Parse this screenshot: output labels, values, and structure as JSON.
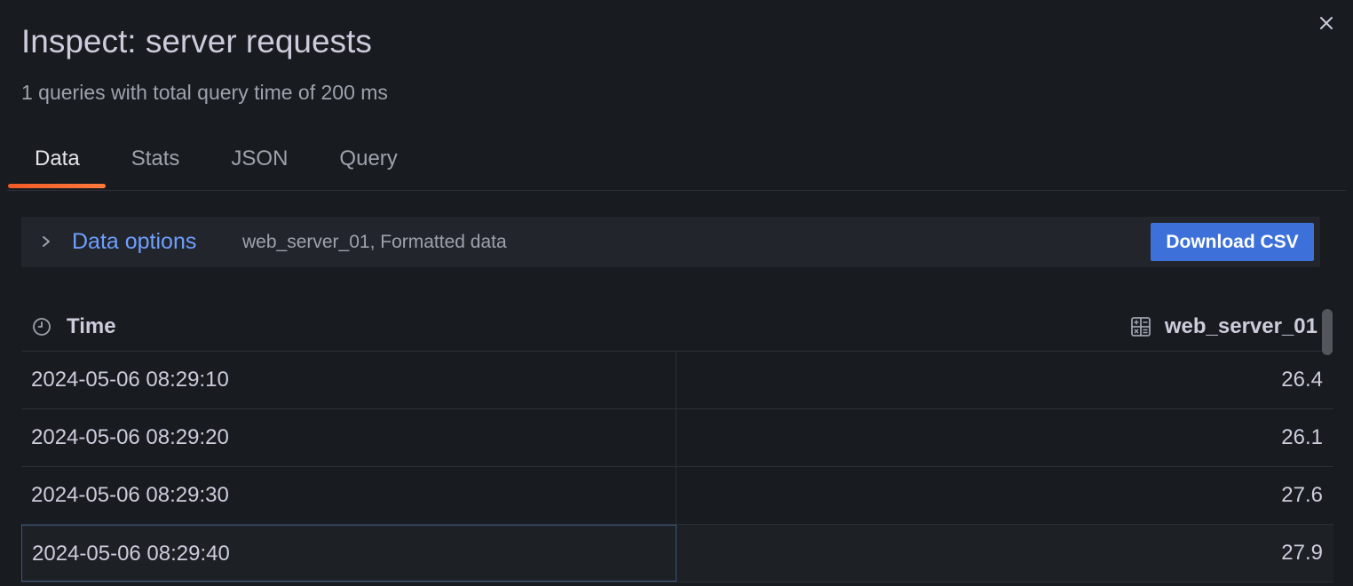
{
  "header": {
    "title": "Inspect: server requests",
    "subtitle": "1 queries with total query time of 200 ms",
    "close_icon": "close-icon"
  },
  "tabs": [
    {
      "label": "Data",
      "active": true
    },
    {
      "label": "Stats",
      "active": false
    },
    {
      "label": "JSON",
      "active": false
    },
    {
      "label": "Query",
      "active": false
    }
  ],
  "data_options": {
    "label": "Data options",
    "description": "web_server_01, Formatted data",
    "download_label": "Download CSV",
    "expand_icon": "chevron-right-icon"
  },
  "table": {
    "columns": [
      {
        "label": "Time",
        "icon": "clock-icon"
      },
      {
        "label": "web_server_01",
        "icon": "calculator-icon"
      }
    ],
    "rows": [
      {
        "time": "2024-05-06 08:29:10",
        "value": "26.4"
      },
      {
        "time": "2024-05-06 08:29:20",
        "value": "26.1"
      },
      {
        "time": "2024-05-06 08:29:30",
        "value": "27.6"
      },
      {
        "time": "2024-05-06 08:29:40",
        "value": "27.9"
      }
    ]
  },
  "colors": {
    "background": "#181b1f",
    "accent_tab": "#f05a28",
    "link": "#6e9fff",
    "primary_button": "#3d71d9"
  }
}
